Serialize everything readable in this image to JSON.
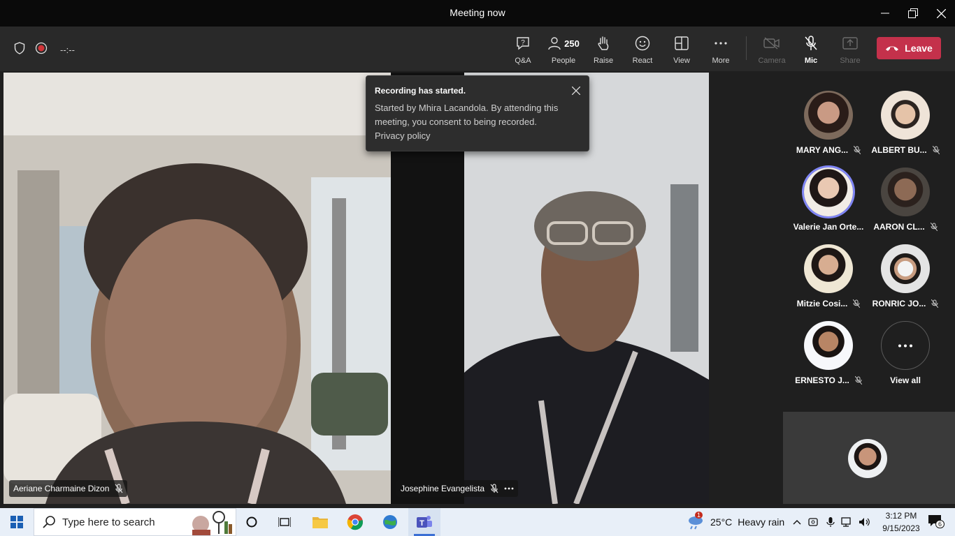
{
  "window": {
    "title": "Meeting now"
  },
  "toolbar": {
    "timer": "--:--",
    "qa_label": "Q&A",
    "people_label": "People",
    "people_count": "250",
    "raise_label": "Raise",
    "react_label": "React",
    "view_label": "View",
    "more_label": "More",
    "camera_label": "Camera",
    "mic_label": "Mic",
    "share_label": "Share",
    "leave_label": "Leave"
  },
  "videos": [
    {
      "name": "Aeriane Charmaine Dizon"
    },
    {
      "name": "Josephine Evangelista"
    }
  ],
  "toast": {
    "title": "Recording has started.",
    "body": "Started by Mhira Lacandola. By attending this meeting, you consent to being recorded.",
    "link": "Privacy policy"
  },
  "participants": [
    {
      "name": "MARY ANG...",
      "muted": true
    },
    {
      "name": "ALBERT BU...",
      "muted": true
    },
    {
      "name": "Valerie Jan Orte...",
      "muted": false,
      "speaking": true
    },
    {
      "name": "AARON CL...",
      "muted": true
    },
    {
      "name": "Mitzie Cosi...",
      "muted": true
    },
    {
      "name": "RONRIC JO...",
      "muted": true
    },
    {
      "name": "ERNESTO J...",
      "muted": true
    }
  ],
  "view_all_label": "View all",
  "taskbar": {
    "search_placeholder": "Type here to search",
    "weather_temp": "25°C",
    "weather_desc": "Heavy rain",
    "weather_badge": "1",
    "time": "3:12 PM",
    "date": "9/15/2023",
    "notification_count": "6"
  },
  "colors": {
    "leave": "#c4314b",
    "speaking_ring": "#7f85f5",
    "record": "#d13438"
  }
}
